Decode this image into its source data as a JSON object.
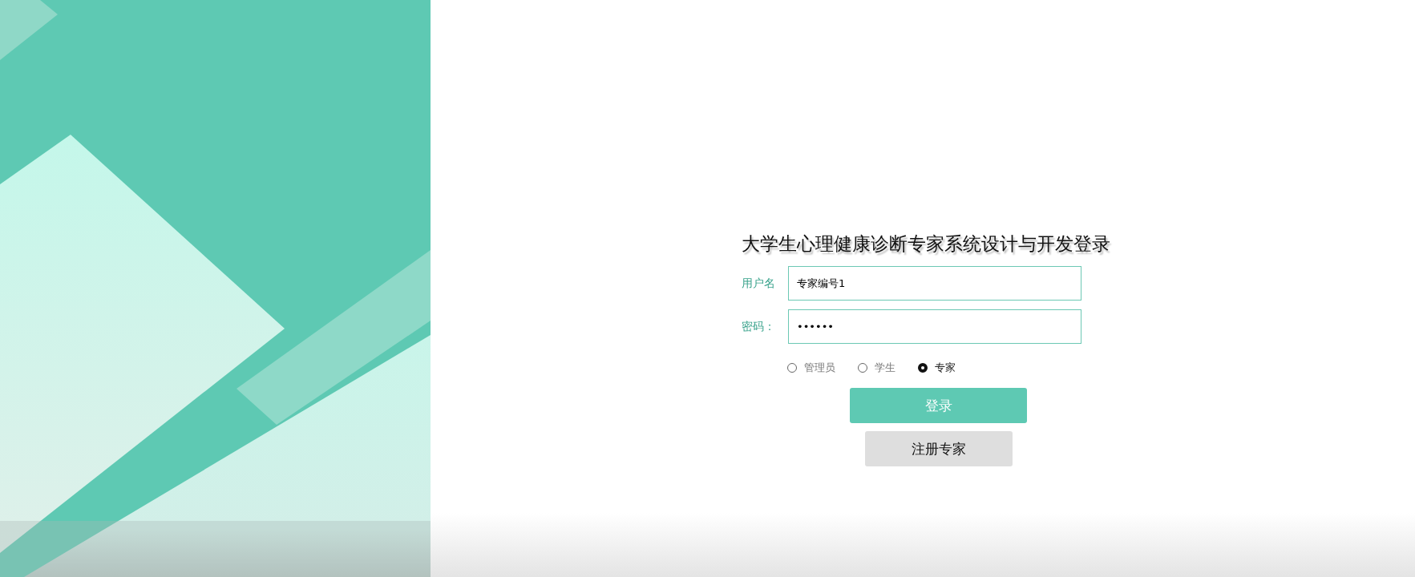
{
  "title": "大学生心理健康诊断专家系统设计与开发登录",
  "fields": [
    {
      "label": "用户名",
      "value": "专家编号1"
    },
    {
      "label": "密码：",
      "value": "••••••"
    }
  ],
  "roles": [
    {
      "label": "管理员",
      "selected": false
    },
    {
      "label": "学生",
      "selected": false
    },
    {
      "label": "专家",
      "selected": true
    }
  ],
  "buttons": [
    {
      "kind": "primary",
      "label": "登录"
    },
    {
      "kind": "secondary",
      "label": "注册专家"
    }
  ]
}
